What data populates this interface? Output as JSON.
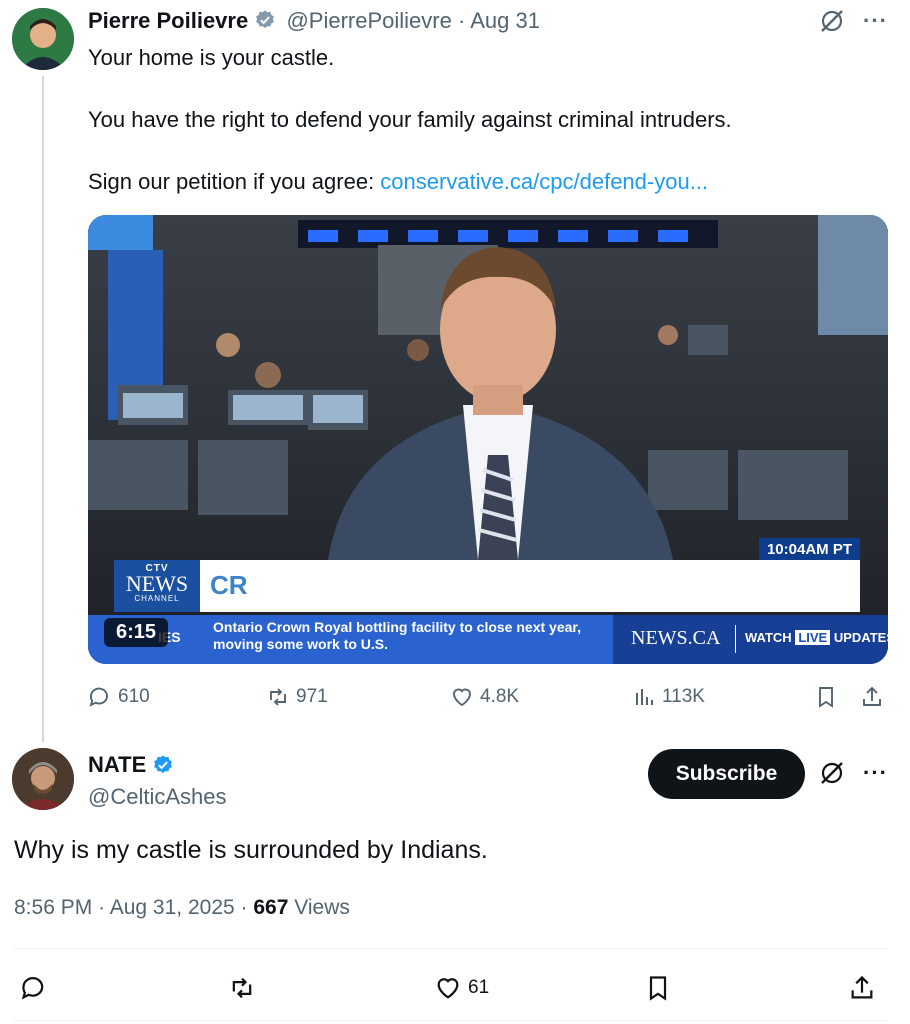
{
  "parent": {
    "author_name": "Pierre Poilievre",
    "handle": "@PierrePoilievre",
    "separator": "·",
    "date": "Aug 31",
    "text_line1": "Your home is your castle.",
    "text_line2": "You have the right to defend your family against criminal intruders.",
    "text_line3_prefix": "Sign our petition if you agree: ",
    "link_text": "conservative.ca/cpc/defend-you...",
    "media": {
      "video_time": "6:15",
      "clock": "10:04AM PT",
      "lower_third_text": "CR",
      "logo_top": "CTV",
      "logo_main": "NEWS",
      "logo_sub": "CHANNEL",
      "ticker_tag": "IES",
      "ticker_line1": "Ontario Crown Royal bottling facility to close next year,",
      "ticker_line2": "moving some work to U.S.",
      "site_logo": "NEWS.CA",
      "watch_prefix": "WATCH",
      "live": "LIVE",
      "watch_suffix": "UPDATES"
    },
    "actions": {
      "replies": "610",
      "reposts": "971",
      "likes": "4.8K",
      "views": "113K"
    }
  },
  "reply": {
    "author_name": "NATE",
    "handle": "@CelticAshes",
    "subscribe_label": "Subscribe",
    "text": "Why is my castle is surrounded by Indians.",
    "time": "8:56 PM",
    "date": "Aug 31, 2025",
    "views_count": "667",
    "views_label": "Views",
    "actions": {
      "likes": "61"
    }
  },
  "colors": {
    "link": "#1d9bf0",
    "verified": "#1d9bf0",
    "muted": "#536471",
    "text": "#0f1419"
  },
  "icons": [
    "verified-gray-badge",
    "grok-icon",
    "more-icon",
    "reply-icon",
    "repost-icon",
    "like-icon",
    "views-icon",
    "bookmark-icon",
    "share-icon",
    "verified-blue-badge"
  ]
}
